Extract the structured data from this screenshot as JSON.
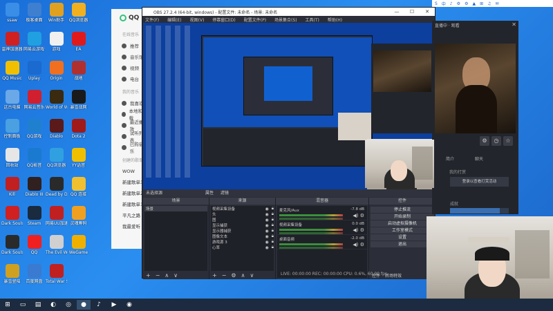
{
  "desktop_icons": [
    {
      "label": "ssaw",
      "icon": "app-icon",
      "color": "#3a8ee6"
    },
    {
      "label": "极客桌面",
      "icon": "desktop-icon",
      "color": "#3e7fd0"
    },
    {
      "label": "Win助手",
      "icon": "assistant-icon",
      "color": "#e0a020"
    },
    {
      "label": "QQ浏览器",
      "icon": "browser-icon",
      "color": "#f0b020"
    },
    {
      "label": "雷神加速器",
      "icon": "accelerator-icon",
      "color": "#d02020"
    },
    {
      "label": "网易云游戏平台",
      "icon": "game-platform-icon",
      "color": "#20a0e0"
    },
    {
      "label": "游戏",
      "icon": "file-icon",
      "color": "#f0f0f0"
    },
    {
      "label": "EA",
      "icon": "ea-icon",
      "color": "#e01a1a"
    },
    {
      "label": "QQ Music",
      "icon": "music-icon",
      "color": "#f0c000"
    },
    {
      "label": "Uplay",
      "icon": "uplay-icon",
      "color": "#1a6ad0"
    },
    {
      "label": "Origin",
      "icon": "origin-icon",
      "color": "#f07020"
    },
    {
      "label": "战地",
      "icon": "battlefield-icon",
      "color": "#b03030"
    },
    {
      "label": "这台电脑",
      "icon": "computer-icon",
      "color": "#6aa8e8"
    },
    {
      "label": "网易云音乐",
      "icon": "netease-music-icon",
      "color": "#d02030"
    },
    {
      "label": "World of Warcraft",
      "icon": "wow-icon",
      "color": "#3a2a10"
    },
    {
      "label": "暴雪战网",
      "icon": "battlenet-icon",
      "color": "#1a1a1a"
    },
    {
      "label": "控制面板",
      "icon": "control-panel-icon",
      "color": "#4aa0e0"
    },
    {
      "label": "QQ游戏",
      "icon": "qq-game-icon",
      "color": "#2080d0"
    },
    {
      "label": "Diablo",
      "icon": "diablo-icon",
      "color": "#5a1a1a"
    },
    {
      "label": "Dota 2",
      "icon": "dota-icon",
      "color": "#a01a1a"
    },
    {
      "label": "回收站",
      "icon": "recycle-bin-icon",
      "color": "#e6e6e6"
    },
    {
      "label": "QQ影音",
      "icon": "video-player-icon",
      "color": "#1a7ad0"
    },
    {
      "label": "QQ浏览器",
      "icon": "browser-icon",
      "color": "#30a0e0"
    },
    {
      "label": "YY语音",
      "icon": "yy-icon",
      "color": "#f0c000"
    },
    {
      "label": "Kill",
      "icon": "kill-icon",
      "color": "#c02020"
    },
    {
      "label": "Diablo III",
      "icon": "diablo3-icon",
      "color": "#302020"
    },
    {
      "label": "Dead by Daylight",
      "icon": "dbd-icon",
      "color": "#2a2a2a"
    },
    {
      "label": "QQ 连接",
      "icon": "qq-link-icon",
      "color": "#f0c030"
    },
    {
      "label": "Dark Souls III",
      "icon": "darksouls-icon",
      "color": "#d02020"
    },
    {
      "label": "Steam",
      "icon": "steam-icon",
      "color": "#1a2a3f"
    },
    {
      "label": "网易UU加速器",
      "icon": "uu-icon",
      "color": "#c02020"
    },
    {
      "label": "灵魂筹码",
      "icon": "soul-icon",
      "color": "#f0a020"
    },
    {
      "label": "Dark Souls",
      "icon": "ds-icon",
      "color": "#2a2a2a"
    },
    {
      "label": "QQ",
      "icon": "qq-icon",
      "color": "#f02020"
    },
    {
      "label": "The Evil Within",
      "icon": "evil-icon",
      "color": "#d0d0d0"
    },
    {
      "label": "WeGame",
      "icon": "wegame-icon",
      "color": "#f0b000"
    },
    {
      "label": "暴雪登陆",
      "icon": "blizzard-icon",
      "color": "#d0a020"
    },
    {
      "label": "百度网盘",
      "icon": "cloud-icon",
      "color": "#3a7ad0"
    },
    {
      "label": "Total War Saga",
      "icon": "totalwar-icon",
      "color": "#c02020"
    }
  ],
  "music_app": {
    "brand": "QQ",
    "section_online": "在线音乐",
    "online_items": [
      "推荐",
      "音乐馆",
      "视频",
      "电台"
    ],
    "section_mine": "我的音乐",
    "mine_items": [
      "我喜欢",
      "本地和下载",
      "最近播放",
      "试听列表",
      "已购音乐"
    ],
    "section_created": "创建的歌单",
    "playlists": [
      "WOW",
      "新建歌单3",
      "新建歌单2",
      "新建歌单1",
      "平凡之路",
      "我最爱听"
    ]
  },
  "obs": {
    "title": "OBS 27.2.4 (64-bit, windows) - 配置文件: 未命名 - 场景: 未命名",
    "menu": [
      "文件(F)",
      "编辑(E)",
      "视图(V)",
      "停靠窗口(D)",
      "配置文件(P)",
      "场景集合(S)",
      "工具(T)",
      "帮助(H)"
    ],
    "win_buttons": [
      "—",
      "☐",
      "✕"
    ],
    "filter_bar": "未选择源",
    "filter_btn_props": "属性",
    "filter_btn_filters": "滤镜",
    "docks": {
      "scenes": {
        "header": "场景",
        "items": [
          "场景"
        ]
      },
      "sources": {
        "header": "来源",
        "items": [
          "视频采集设备",
          "头",
          "图",
          "显示捕获",
          "显示器捕获",
          "图像文本",
          "游戏源 3",
          "心率"
        ]
      },
      "mixer": {
        "header": "混音器",
        "channels": [
          {
            "name": "麦克风/Aux",
            "db": "-7.8 dB"
          },
          {
            "name": "视频采集设备",
            "db": "0.0 dB"
          },
          {
            "name": "桌面音频",
            "db": "-2.0 dB"
          }
        ]
      },
      "controls": {
        "header": "控件",
        "buttons": [
          "停止推流",
          "开始录制",
          "启动虚拟摄像机",
          "工作室模式",
          "设置",
          "退出"
        ],
        "tabs": [
          "控件",
          "转场特效"
        ]
      }
    },
    "status": "LIVE: 00:00:00   REC: 00:00:00   CPU: 0.6%, 60.00 fps"
  },
  "stream_client": {
    "header": "直播中 · 观看",
    "tab_left": "简介",
    "tab_right": "聊天",
    "login_tip": "我的打赏",
    "login_button": "登录以查看打赏活动",
    "section2": "成就",
    "progress_label": "我的成就 22/26"
  },
  "tray": {
    "items": [
      "S",
      "中",
      "♪",
      "⚙",
      "⚙",
      "▲",
      "⊞",
      "♫",
      "✉"
    ]
  },
  "taskbar": {
    "items": [
      {
        "icon": "windows-start-icon",
        "glyph": "⊞"
      },
      {
        "icon": "explorer-icon",
        "glyph": "▭"
      },
      {
        "icon": "folder-icon",
        "glyph": "▤"
      },
      {
        "icon": "qq-browser-icon",
        "glyph": "◐"
      },
      {
        "icon": "steam-taskbar-icon",
        "glyph": "◎"
      },
      {
        "icon": "obs-taskbar-icon",
        "glyph": "●"
      },
      {
        "icon": "music-taskbar-icon",
        "glyph": "♪"
      },
      {
        "icon": "stream-taskbar-icon",
        "glyph": "▶"
      },
      {
        "icon": "game-taskbar-icon",
        "glyph": "◉"
      }
    ]
  }
}
